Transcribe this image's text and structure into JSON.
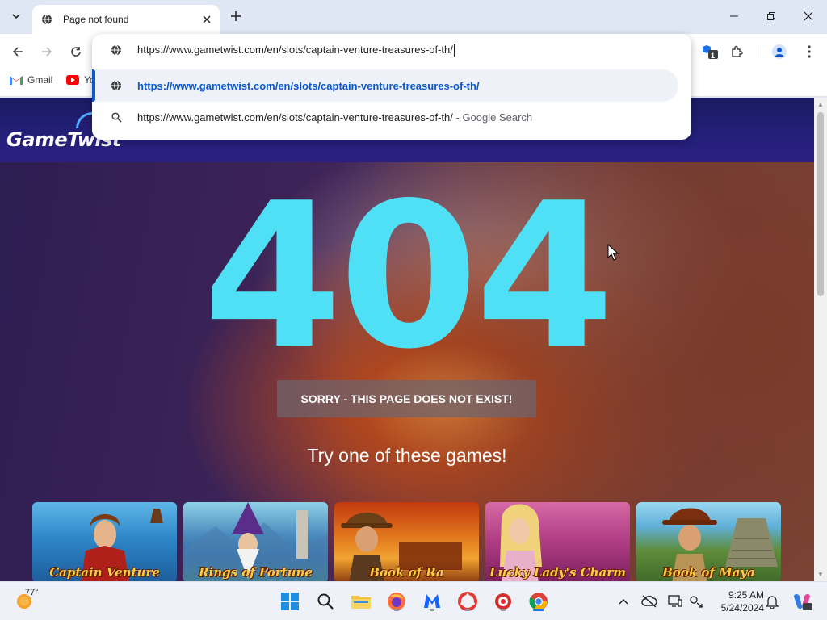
{
  "browser": {
    "tab": {
      "title": "Page not found"
    },
    "omnibox": {
      "input_text": "https://www.gametwist.com/en/slots/captain-venture-treasures-of-th/",
      "suggestion_url": "https://www.gametwist.com/en/slots/captain-venture-treasures-of-th/",
      "search_query": "https://www.gametwist.com/en/slots/captain-venture-treasures-of-th/",
      "search_suffix": " - Google Search"
    },
    "bookmarks": [
      {
        "label": "Gmail",
        "icon": "gmail-icon"
      },
      {
        "label": "Yo",
        "icon": "youtube-icon"
      }
    ],
    "extension_badge": "1"
  },
  "site": {
    "logo": "GameTwist",
    "error_code": "404",
    "error_message": "SORRY - THIS PAGE DOES NOT EXIST!",
    "suggestion_heading": "Try one of these games!",
    "games": [
      {
        "name": "Captain Venture"
      },
      {
        "name": "Rings of Fortune"
      },
      {
        "name": "Book of Ra"
      },
      {
        "name": "Lucky Lady's Charm"
      },
      {
        "name": "Book of Maya"
      }
    ]
  },
  "taskbar": {
    "weather": "77°",
    "time": "9:25 AM",
    "date": "5/24/2024"
  },
  "colors": {
    "accent_blue": "#0b57d0",
    "error_cyan": "#4fe0f5",
    "header_navy": "#1a1a62"
  }
}
